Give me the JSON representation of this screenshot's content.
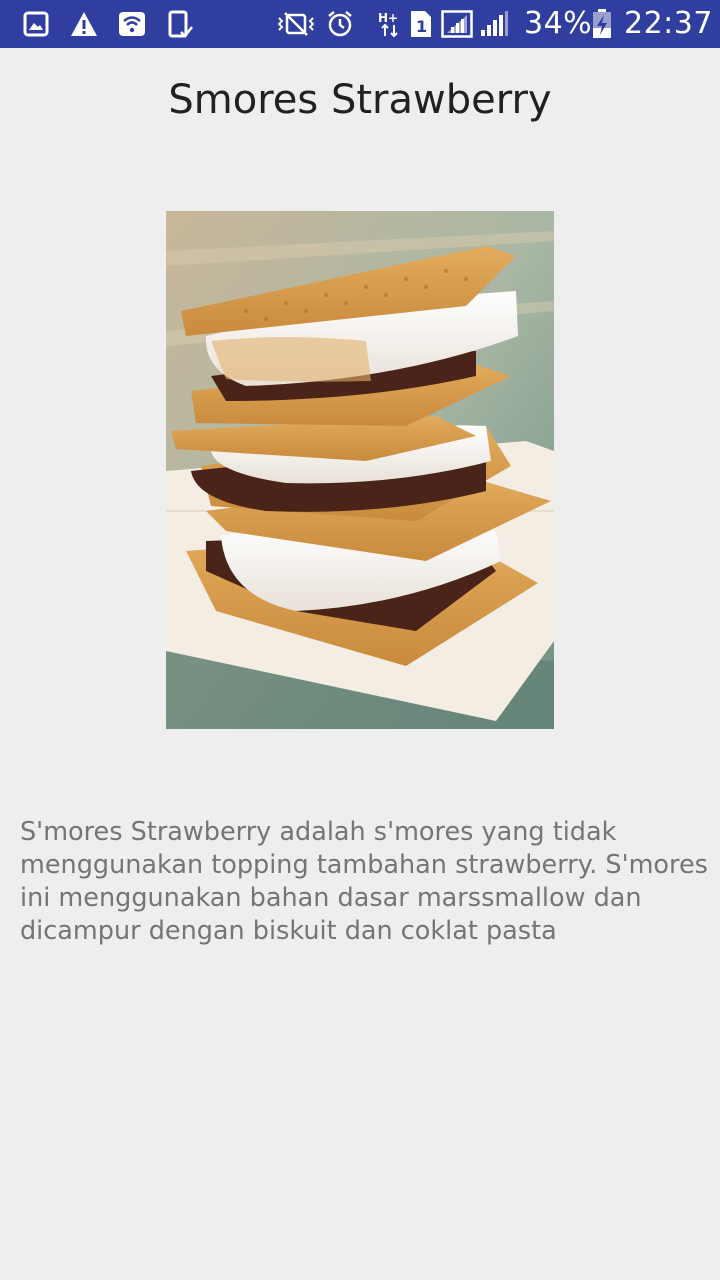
{
  "status_bar": {
    "battery_percent": "34%",
    "time": "22:37",
    "left_icons": [
      "image-icon",
      "warning-icon",
      "wifi-icon",
      "phone-screen-icon"
    ],
    "right_icons": [
      "vibrate-icon",
      "alarm-icon",
      "hplus-data-icon",
      "sim-1-icon",
      "signal-icon",
      "signal-icon",
      "battery-charging-icon"
    ]
  },
  "page": {
    "title": "Smores Strawberry",
    "image_alt": "S'mores stack photo",
    "description": "S'mores Strawberry adalah s'mores yang tidak menggunakan topping tambahan strawberry. S'mores ini menggunakan bahan dasar marssmallow dan dicampur dengan biskuit dan coklat pasta"
  },
  "colors": {
    "status_bar": "#303f9f",
    "background": "#eeeeee",
    "title_text": "#212121",
    "body_text": "#757575"
  }
}
